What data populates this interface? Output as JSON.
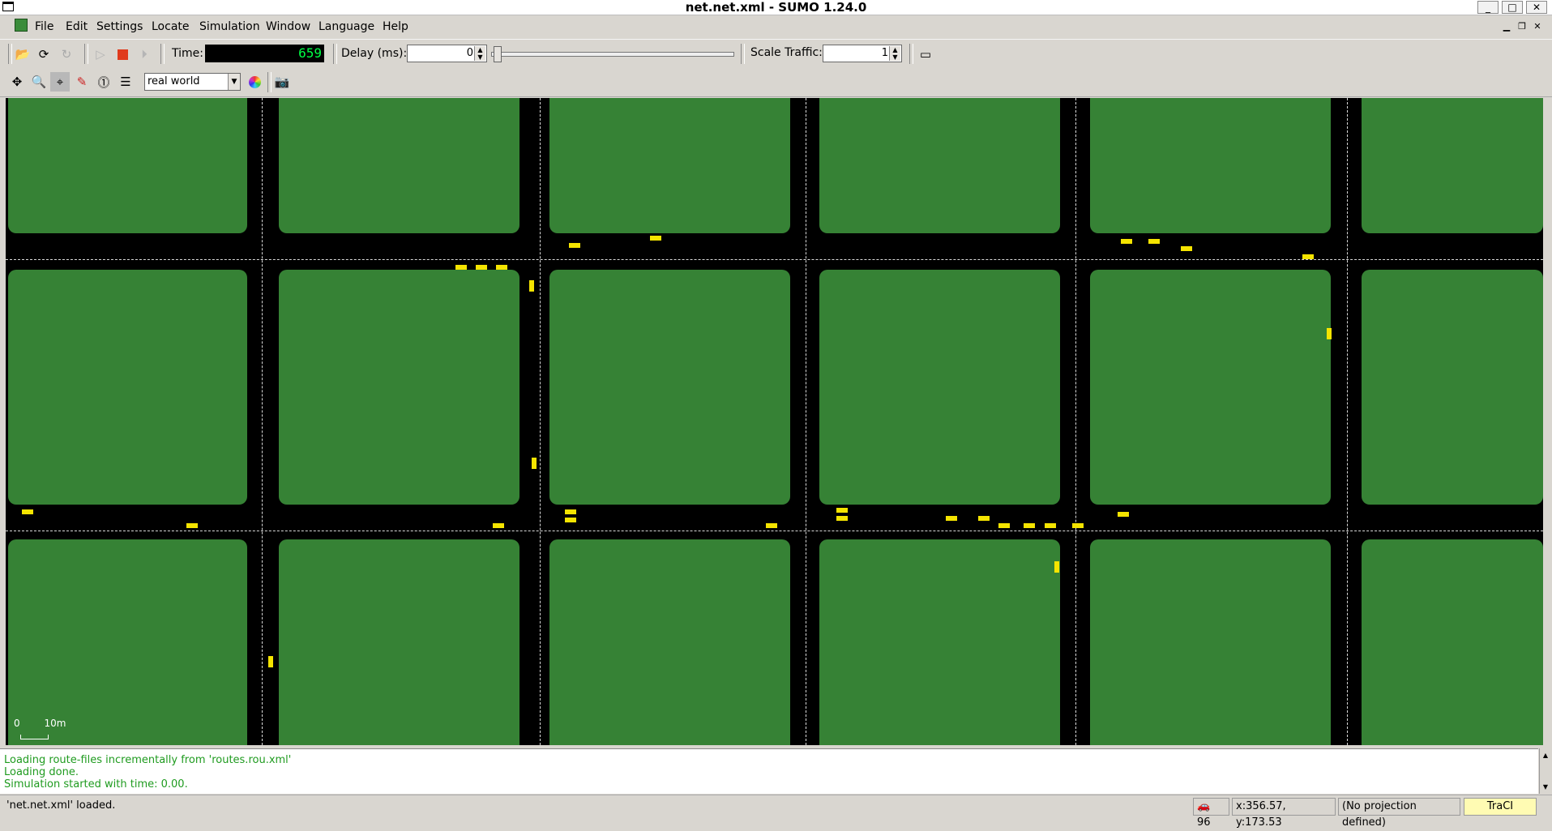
{
  "window": {
    "title": "net.net.xml - SUMO 1.24.0"
  },
  "menu": {
    "items": [
      "File",
      "Edit",
      "Settings",
      "Locate",
      "Simulation",
      "Window",
      "Language",
      "Help"
    ]
  },
  "toolbar": {
    "time_label": "Time:",
    "time_value": "659",
    "delay_label": "Delay (ms):",
    "delay_value": "0",
    "delay_slider": 0,
    "scale_label": "Scale Traffic:",
    "scale_value": "1"
  },
  "view": {
    "scheme": "real world"
  },
  "scale": {
    "zero": "0",
    "length": "10m"
  },
  "messages": [
    "Loading route-files incrementally from 'routes.rou.xml'",
    "Loading done.",
    "Simulation started with time: 0.00."
  ],
  "status": {
    "message": "'net.net.xml' loaded.",
    "vehicle_count": "96",
    "coords": "x:356.57, y:173.53",
    "projection": "(No projection defined)",
    "traci": "TraCI"
  },
  "colors": {
    "grass": "#368235",
    "road": "#000000",
    "vehicle": "#f5e400",
    "stopline": "#e02020",
    "message": "#1f9b1f"
  },
  "icons": [
    "open-icon",
    "reload-icon",
    "run-icon",
    "stop-icon",
    "step-icon",
    "recenter-icon",
    "zoom-icon",
    "locate-icon",
    "editor-icon",
    "edit-breakpoints-icon",
    "color-wheel-icon",
    "camera-icon"
  ]
}
